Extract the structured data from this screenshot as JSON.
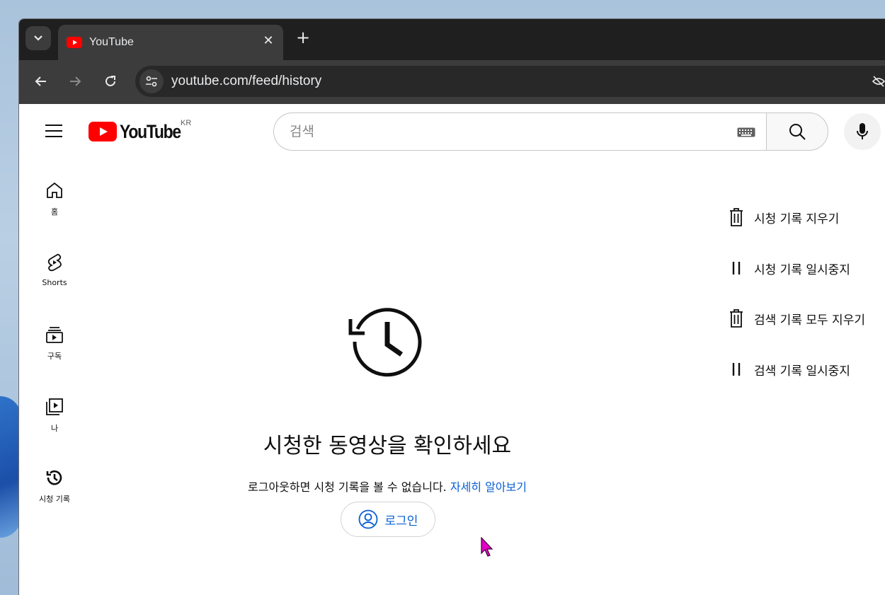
{
  "browser": {
    "tab": {
      "title": "YouTube"
    },
    "url": "youtube.com/feed/history"
  },
  "header": {
    "logo_text": "YouTube",
    "country_code": "KR",
    "search": {
      "placeholder": "검색"
    }
  },
  "sidebar": {
    "items": [
      {
        "label": "홈",
        "icon": "home-icon"
      },
      {
        "label": "Shorts",
        "icon": "shorts-icon"
      },
      {
        "label": "구독",
        "icon": "subscriptions-icon"
      },
      {
        "label": "나",
        "icon": "you-icon"
      },
      {
        "label": "시청 기록",
        "icon": "history-icon"
      }
    ]
  },
  "actions": [
    {
      "label": "시청 기록 지우기",
      "icon": "trash-icon"
    },
    {
      "label": "시청 기록 일시중지",
      "icon": "pause-icon"
    },
    {
      "label": "검색 기록 모두 지우기",
      "icon": "trash-icon"
    },
    {
      "label": "검색 기록 일시중지",
      "icon": "pause-icon"
    }
  ],
  "main": {
    "title": "시청한 동영상을 확인하세요",
    "description": "로그아웃하면 시청 기록을 볼 수 없습니다.",
    "learn_more": "자세히 알아보기",
    "login_label": "로그인"
  },
  "colors": {
    "brand_red": "#ff0000",
    "link_blue": "#065fd4",
    "cursor_magenta": "#e600c8"
  }
}
